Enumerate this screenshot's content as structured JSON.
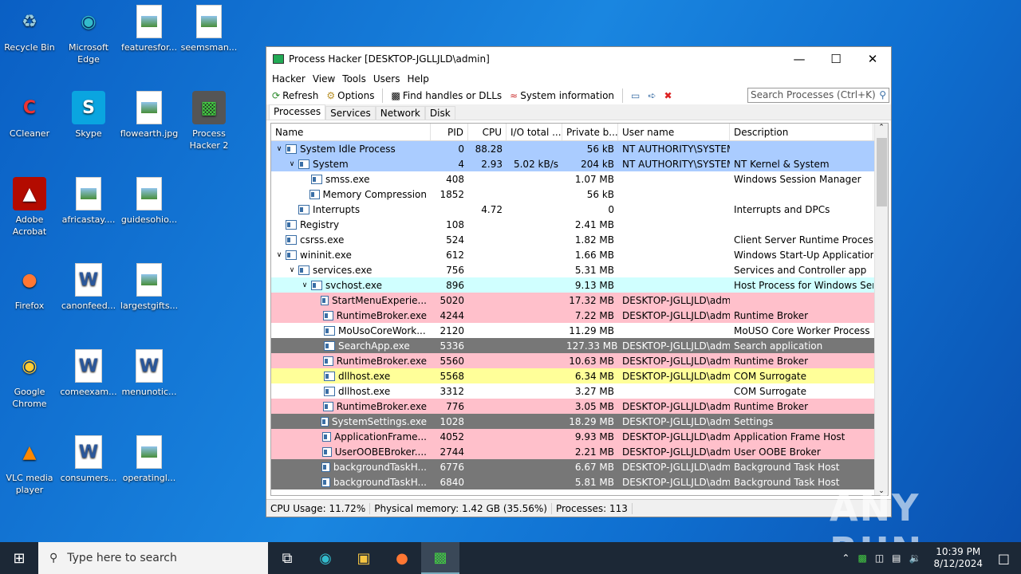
{
  "desktop": [
    {
      "label": "Recycle Bin",
      "icon": "recycle-bin-icon",
      "kind": "bin",
      "col": 0,
      "row": 0
    },
    {
      "label": "Microsoft Edge",
      "icon": "edge-icon",
      "kind": "edge",
      "col": 1,
      "row": 0
    },
    {
      "label": "featuresfor...",
      "icon": "image-file-icon",
      "kind": "file",
      "col": 2,
      "row": 0
    },
    {
      "label": "seemsman...",
      "icon": "image-file-icon",
      "kind": "file",
      "col": 3,
      "row": 0
    },
    {
      "label": "CCleaner",
      "icon": "ccleaner-icon",
      "kind": "cc",
      "col": 0,
      "row": 1
    },
    {
      "label": "Skype",
      "icon": "skype-icon",
      "kind": "skype",
      "col": 1,
      "row": 1
    },
    {
      "label": "flowearth.jpg",
      "icon": "image-file-icon",
      "kind": "file",
      "col": 2,
      "row": 1
    },
    {
      "label": "Process Hacker 2",
      "icon": "process-hacker-icon",
      "kind": "ph",
      "col": 3,
      "row": 1
    },
    {
      "label": "Adobe Acrobat",
      "icon": "acrobat-icon",
      "kind": "pdf",
      "col": 0,
      "row": 2
    },
    {
      "label": "africastay....",
      "icon": "image-file-icon",
      "kind": "file",
      "col": 1,
      "row": 2
    },
    {
      "label": "guidesohio...",
      "icon": "image-file-icon",
      "kind": "file",
      "col": 2,
      "row": 2
    },
    {
      "label": "Firefox",
      "icon": "firefox-icon",
      "kind": "ff",
      "col": 0,
      "row": 3
    },
    {
      "label": "canonfeed...",
      "icon": "word-doc-icon",
      "kind": "word",
      "col": 1,
      "row": 3
    },
    {
      "label": "largestgifts...",
      "icon": "image-file-icon",
      "kind": "file",
      "col": 2,
      "row": 3
    },
    {
      "label": "Google Chrome",
      "icon": "chrome-icon",
      "kind": "chrome",
      "col": 0,
      "row": 4
    },
    {
      "label": "comeexam...",
      "icon": "word-doc-icon",
      "kind": "word",
      "col": 1,
      "row": 4
    },
    {
      "label": "menunotic...",
      "icon": "word-doc-icon",
      "kind": "word",
      "col": 2,
      "row": 4
    },
    {
      "label": "VLC media player",
      "icon": "vlc-icon",
      "kind": "vlc",
      "col": 0,
      "row": 5
    },
    {
      "label": "consumers...",
      "icon": "word-doc-icon",
      "kind": "word",
      "col": 1,
      "row": 5
    },
    {
      "label": "operatingl...",
      "icon": "image-file-icon",
      "kind": "file",
      "col": 2,
      "row": 5
    }
  ],
  "window": {
    "title": "Process Hacker [DESKTOP-JGLLJLD\\admin]",
    "menu": [
      "Hacker",
      "View",
      "Tools",
      "Users",
      "Help"
    ],
    "toolbar": {
      "refresh": "Refresh",
      "options": "Options",
      "find": "Find handles or DLLs",
      "sysinfo": "System information"
    },
    "search_placeholder": "Search Processes (Ctrl+K)",
    "tabs": [
      "Processes",
      "Services",
      "Network",
      "Disk"
    ],
    "columns": [
      "Name",
      "PID",
      "CPU",
      "I/O total ...",
      "Private b...",
      "User name",
      "Description"
    ],
    "rows": [
      {
        "d": 0,
        "e": 1,
        "c": "#aaccff",
        "v": [
          "System Idle Process",
          "0",
          "88.28",
          "",
          "56 kB",
          "NT AUTHORITY\\SYSTEM",
          ""
        ]
      },
      {
        "d": 1,
        "e": 1,
        "c": "#aaccff",
        "v": [
          "System",
          "4",
          "2.93",
          "5.02 kB/s",
          "204 kB",
          "NT AUTHORITY\\SYSTEM",
          "NT Kernel & System"
        ]
      },
      {
        "d": 2,
        "e": 0,
        "c": "#ffffff",
        "v": [
          "smss.exe",
          "408",
          "",
          "",
          "1.07 MB",
          "",
          "Windows Session Manager"
        ]
      },
      {
        "d": 2,
        "e": 0,
        "c": "#ffffff",
        "v": [
          "Memory Compression",
          "1852",
          "",
          "",
          "56 kB",
          "",
          ""
        ]
      },
      {
        "d": 1,
        "e": 0,
        "c": "#ffffff",
        "v": [
          "Interrupts",
          "",
          "4.72",
          "",
          "0",
          "",
          "Interrupts and DPCs"
        ]
      },
      {
        "d": 0,
        "e": 0,
        "c": "#ffffff",
        "v": [
          "Registry",
          "108",
          "",
          "",
          "2.41 MB",
          "",
          ""
        ]
      },
      {
        "d": 0,
        "e": 0,
        "c": "#ffffff",
        "v": [
          "csrss.exe",
          "524",
          "",
          "",
          "1.82 MB",
          "",
          "Client Server Runtime Process"
        ]
      },
      {
        "d": 0,
        "e": 1,
        "c": "#ffffff",
        "v": [
          "wininit.exe",
          "612",
          "",
          "",
          "1.66 MB",
          "",
          "Windows Start-Up Application"
        ]
      },
      {
        "d": 1,
        "e": 1,
        "c": "#ffffff",
        "v": [
          "services.exe",
          "756",
          "",
          "",
          "5.31 MB",
          "",
          "Services and Controller app"
        ]
      },
      {
        "d": 2,
        "e": 1,
        "c": "#d0ffff",
        "v": [
          "svchost.exe",
          "896",
          "",
          "",
          "9.13 MB",
          "",
          "Host Process for Windows Ser..."
        ]
      },
      {
        "d": 3,
        "e": 0,
        "c": "#ffc0cb",
        "v": [
          "StartMenuExperie...",
          "5020",
          "",
          "",
          "17.32 MB",
          "DESKTOP-JGLLJLD\\admi",
          ""
        ]
      },
      {
        "d": 3,
        "e": 0,
        "c": "#ffc0cb",
        "v": [
          "RuntimeBroker.exe",
          "4244",
          "",
          "",
          "7.22 MB",
          "DESKTOP-JGLLJLD\\admi",
          "Runtime Broker"
        ]
      },
      {
        "d": 3,
        "e": 0,
        "c": "#ffffff",
        "v": [
          "MoUsoCoreWork...",
          "2120",
          "",
          "",
          "11.29 MB",
          "",
          "MoUSO Core Worker Process"
        ]
      },
      {
        "d": 3,
        "e": 0,
        "c": "#777777",
        "v": [
          "SearchApp.exe",
          "5336",
          "",
          "",
          "127.33 MB",
          "DESKTOP-JGLLJLD\\admi",
          "Search application"
        ]
      },
      {
        "d": 3,
        "e": 0,
        "c": "#ffc0cb",
        "v": [
          "RuntimeBroker.exe",
          "5560",
          "",
          "",
          "10.63 MB",
          "DESKTOP-JGLLJLD\\admi",
          "Runtime Broker"
        ]
      },
      {
        "d": 3,
        "e": 0,
        "c": "#ffff99",
        "v": [
          "dllhost.exe",
          "5568",
          "",
          "",
          "6.34 MB",
          "DESKTOP-JGLLJLD\\admi",
          "COM Surrogate"
        ]
      },
      {
        "d": 3,
        "e": 0,
        "c": "#ffffff",
        "v": [
          "dllhost.exe",
          "3312",
          "",
          "",
          "3.27 MB",
          "",
          "COM Surrogate"
        ]
      },
      {
        "d": 3,
        "e": 0,
        "c": "#ffc0cb",
        "v": [
          "RuntimeBroker.exe",
          "776",
          "",
          "",
          "3.05 MB",
          "DESKTOP-JGLLJLD\\admi",
          "Runtime Broker"
        ]
      },
      {
        "d": 3,
        "e": 0,
        "c": "#777777",
        "v": [
          "SystemSettings.exe",
          "1028",
          "",
          "",
          "18.29 MB",
          "DESKTOP-JGLLJLD\\admi",
          "Settings"
        ]
      },
      {
        "d": 3,
        "e": 0,
        "c": "#ffc0cb",
        "v": [
          "ApplicationFrame...",
          "4052",
          "",
          "",
          "9.93 MB",
          "DESKTOP-JGLLJLD\\admi",
          "Application Frame Host"
        ]
      },
      {
        "d": 3,
        "e": 0,
        "c": "#ffc0cb",
        "v": [
          "UserOOBEBroker....",
          "2744",
          "",
          "",
          "2.21 MB",
          "DESKTOP-JGLLJLD\\admi",
          "User OOBE Broker"
        ]
      },
      {
        "d": 3,
        "e": 0,
        "c": "#777777",
        "v": [
          "backgroundTaskH...",
          "6776",
          "",
          "",
          "6.67 MB",
          "DESKTOP-JGLLJLD\\admi",
          "Background Task Host"
        ]
      },
      {
        "d": 3,
        "e": 0,
        "c": "#777777",
        "v": [
          "backgroundTaskH...",
          "6840",
          "",
          "",
          "5.81 MB",
          "DESKTOP-JGLLJLD\\admi",
          "Background Task Host"
        ]
      }
    ],
    "status": {
      "cpu": "CPU Usage: 11.72%",
      "mem": "Physical memory: 1.42 GB (35.56%)",
      "procs": "Processes: 113"
    }
  },
  "taskbar": {
    "search_placeholder": "Type here to search",
    "time": "10:39 PM",
    "date": "8/12/2024"
  },
  "watermark": "ANY RUN"
}
